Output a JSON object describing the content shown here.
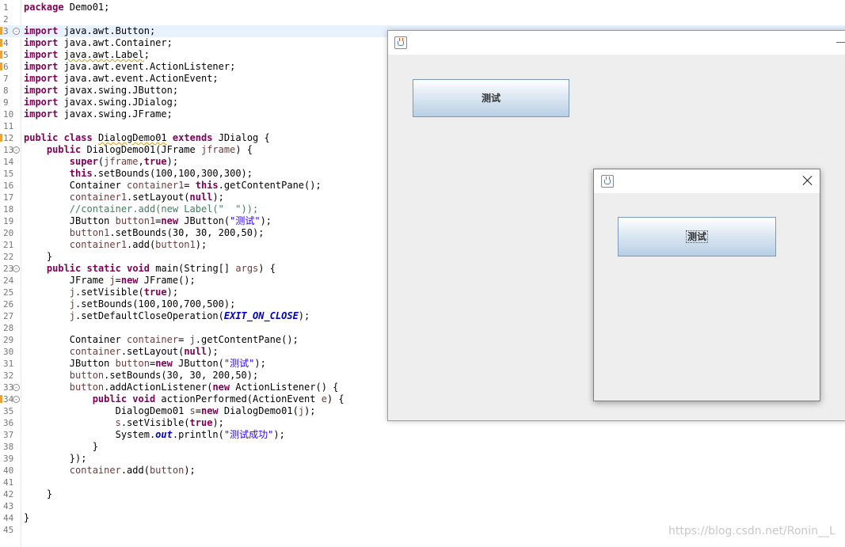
{
  "editor": {
    "lines": [
      {
        "n": "1",
        "tokens": [
          {
            "t": "package",
            "c": "kw"
          },
          {
            "t": " Demo01;"
          }
        ]
      },
      {
        "n": "2",
        "tokens": []
      },
      {
        "n": "3",
        "fold": true,
        "marker": true,
        "hl": true,
        "tokens": [
          {
            "t": "import",
            "c": "kw"
          },
          {
            "t": " java.awt.Button;"
          }
        ]
      },
      {
        "n": "4",
        "marker": true,
        "tokens": [
          {
            "t": "import",
            "c": "kw"
          },
          {
            "t": " java.awt.Container;"
          }
        ]
      },
      {
        "n": "5",
        "marker": true,
        "tokens": [
          {
            "t": "import",
            "c": "kw"
          },
          {
            "t": " "
          },
          {
            "t": "java.awt.Label",
            "c": "squig"
          },
          {
            "t": ";"
          }
        ]
      },
      {
        "n": "6",
        "marker": true,
        "tokens": [
          {
            "t": "import",
            "c": "kw"
          },
          {
            "t": " java.awt.event.ActionListener;"
          }
        ]
      },
      {
        "n": "7",
        "tokens": [
          {
            "t": "import",
            "c": "kw"
          },
          {
            "t": " java.awt.event.ActionEvent;"
          }
        ]
      },
      {
        "n": "8",
        "tokens": [
          {
            "t": "import",
            "c": "kw"
          },
          {
            "t": " javax.swing.JButton;"
          }
        ]
      },
      {
        "n": "9",
        "tokens": [
          {
            "t": "import",
            "c": "kw"
          },
          {
            "t": " javax.swing.JDialog;"
          }
        ]
      },
      {
        "n": "10",
        "tokens": [
          {
            "t": "import",
            "c": "kw"
          },
          {
            "t": " javax.swing.JFrame;"
          }
        ]
      },
      {
        "n": "11",
        "tokens": []
      },
      {
        "n": "12",
        "marker": true,
        "tokens": [
          {
            "t": "public",
            "c": "kw"
          },
          {
            "t": " "
          },
          {
            "t": "class",
            "c": "kw"
          },
          {
            "t": " "
          },
          {
            "t": "DialogDemo01",
            "c": "squig"
          },
          {
            "t": " "
          },
          {
            "t": "extends",
            "c": "kw"
          },
          {
            "t": " JDialog {"
          }
        ]
      },
      {
        "n": "13",
        "fold": true,
        "tokens": [
          {
            "t": "    "
          },
          {
            "t": "public",
            "c": "kw"
          },
          {
            "t": " DialogDemo01(JFrame "
          },
          {
            "t": "jframe",
            "c": "var"
          },
          {
            "t": ") {"
          }
        ]
      },
      {
        "n": "14",
        "tokens": [
          {
            "t": "        "
          },
          {
            "t": "super",
            "c": "kw"
          },
          {
            "t": "("
          },
          {
            "t": "jframe",
            "c": "var"
          },
          {
            "t": ","
          },
          {
            "t": "true",
            "c": "kw"
          },
          {
            "t": ");"
          }
        ]
      },
      {
        "n": "15",
        "tokens": [
          {
            "t": "        "
          },
          {
            "t": "this",
            "c": "kw"
          },
          {
            "t": ".setBounds(100,100,300,300);"
          }
        ]
      },
      {
        "n": "16",
        "tokens": [
          {
            "t": "        Container "
          },
          {
            "t": "container1",
            "c": "var"
          },
          {
            "t": "= "
          },
          {
            "t": "this",
            "c": "kw"
          },
          {
            "t": ".getContentPane();"
          }
        ]
      },
      {
        "n": "17",
        "tokens": [
          {
            "t": "        "
          },
          {
            "t": "container1",
            "c": "var"
          },
          {
            "t": ".setLayout("
          },
          {
            "t": "null",
            "c": "kw"
          },
          {
            "t": ");"
          }
        ]
      },
      {
        "n": "18",
        "tokens": [
          {
            "t": "        "
          },
          {
            "t": "//container.add(new Label(\"  \"));",
            "c": "cm"
          }
        ]
      },
      {
        "n": "19",
        "tokens": [
          {
            "t": "        JButton "
          },
          {
            "t": "button1",
            "c": "var"
          },
          {
            "t": "="
          },
          {
            "t": "new",
            "c": "kw"
          },
          {
            "t": " JButton("
          },
          {
            "t": "\"测试\"",
            "c": "str"
          },
          {
            "t": ");"
          }
        ]
      },
      {
        "n": "20",
        "tokens": [
          {
            "t": "        "
          },
          {
            "t": "button1",
            "c": "var"
          },
          {
            "t": ".setBounds(30, 30, 200,50);"
          }
        ]
      },
      {
        "n": "21",
        "tokens": [
          {
            "t": "        "
          },
          {
            "t": "container1",
            "c": "var"
          },
          {
            "t": ".add("
          },
          {
            "t": "button1",
            "c": "var"
          },
          {
            "t": ");"
          }
        ]
      },
      {
        "n": "22",
        "tokens": [
          {
            "t": "    }"
          }
        ]
      },
      {
        "n": "23",
        "fold": true,
        "tokens": [
          {
            "t": "    "
          },
          {
            "t": "public",
            "c": "kw"
          },
          {
            "t": " "
          },
          {
            "t": "static",
            "c": "kw"
          },
          {
            "t": " "
          },
          {
            "t": "void",
            "c": "kw"
          },
          {
            "t": " main(String[] "
          },
          {
            "t": "args",
            "c": "var"
          },
          {
            "t": ") {"
          }
        ]
      },
      {
        "n": "24",
        "tokens": [
          {
            "t": "        JFrame "
          },
          {
            "t": "j",
            "c": "var"
          },
          {
            "t": "="
          },
          {
            "t": "new",
            "c": "kw"
          },
          {
            "t": " JFrame();"
          }
        ]
      },
      {
        "n": "25",
        "tokens": [
          {
            "t": "        "
          },
          {
            "t": "j",
            "c": "var"
          },
          {
            "t": ".setVisible("
          },
          {
            "t": "true",
            "c": "kw"
          },
          {
            "t": ");"
          }
        ]
      },
      {
        "n": "26",
        "tokens": [
          {
            "t": "        "
          },
          {
            "t": "j",
            "c": "var"
          },
          {
            "t": ".setBounds(100,100,700,500);"
          }
        ]
      },
      {
        "n": "27",
        "tokens": [
          {
            "t": "        "
          },
          {
            "t": "j",
            "c": "var"
          },
          {
            "t": ".setDefaultCloseOperation("
          },
          {
            "t": "EXIT_ON_CLOSE",
            "c": "fld"
          },
          {
            "t": ");"
          }
        ]
      },
      {
        "n": "28",
        "tokens": []
      },
      {
        "n": "29",
        "tokens": [
          {
            "t": "        Container "
          },
          {
            "t": "container",
            "c": "var"
          },
          {
            "t": "= "
          },
          {
            "t": "j",
            "c": "var"
          },
          {
            "t": ".getContentPane();"
          }
        ]
      },
      {
        "n": "30",
        "tokens": [
          {
            "t": "        "
          },
          {
            "t": "container",
            "c": "var"
          },
          {
            "t": ".setLayout("
          },
          {
            "t": "null",
            "c": "kw"
          },
          {
            "t": ");"
          }
        ]
      },
      {
        "n": "31",
        "tokens": [
          {
            "t": "        JButton "
          },
          {
            "t": "button",
            "c": "var"
          },
          {
            "t": "="
          },
          {
            "t": "new",
            "c": "kw"
          },
          {
            "t": " JButton("
          },
          {
            "t": "\"测试\"",
            "c": "str"
          },
          {
            "t": ");"
          }
        ]
      },
      {
        "n": "32",
        "tokens": [
          {
            "t": "        "
          },
          {
            "t": "button",
            "c": "var"
          },
          {
            "t": ".setBounds(30, 30, 200,50);"
          }
        ]
      },
      {
        "n": "33",
        "fold": true,
        "tokens": [
          {
            "t": "        "
          },
          {
            "t": "button",
            "c": "var"
          },
          {
            "t": ".addActionListener("
          },
          {
            "t": "new",
            "c": "kw"
          },
          {
            "t": " ActionListener() {"
          }
        ]
      },
      {
        "n": "34",
        "fold": true,
        "marker": true,
        "tokens": [
          {
            "t": "            "
          },
          {
            "t": "public",
            "c": "kw"
          },
          {
            "t": " "
          },
          {
            "t": "void",
            "c": "kw"
          },
          {
            "t": " actionPerformed(ActionEvent "
          },
          {
            "t": "e",
            "c": "var"
          },
          {
            "t": ") {"
          }
        ]
      },
      {
        "n": "35",
        "tokens": [
          {
            "t": "                DialogDemo01 "
          },
          {
            "t": "s",
            "c": "var"
          },
          {
            "t": "="
          },
          {
            "t": "new",
            "c": "kw"
          },
          {
            "t": " DialogDemo01("
          },
          {
            "t": "j",
            "c": "var"
          },
          {
            "t": ");"
          }
        ]
      },
      {
        "n": "36",
        "tokens": [
          {
            "t": "                "
          },
          {
            "t": "s",
            "c": "var"
          },
          {
            "t": ".setVisible("
          },
          {
            "t": "true",
            "c": "kw"
          },
          {
            "t": ");"
          }
        ]
      },
      {
        "n": "37",
        "tokens": [
          {
            "t": "                System."
          },
          {
            "t": "out",
            "c": "fld"
          },
          {
            "t": ".println("
          },
          {
            "t": "\"测试成功\"",
            "c": "str"
          },
          {
            "t": ");"
          }
        ]
      },
      {
        "n": "38",
        "tokens": [
          {
            "t": "            }"
          }
        ]
      },
      {
        "n": "39",
        "tokens": [
          {
            "t": "        });"
          }
        ]
      },
      {
        "n": "40",
        "tokens": [
          {
            "t": "        "
          },
          {
            "t": "container",
            "c": "var"
          },
          {
            "t": ".add("
          },
          {
            "t": "button",
            "c": "var"
          },
          {
            "t": ");"
          }
        ]
      },
      {
        "n": "41",
        "tokens": []
      },
      {
        "n": "42",
        "tokens": [
          {
            "t": "    }"
          }
        ]
      },
      {
        "n": "43",
        "tokens": []
      },
      {
        "n": "44",
        "tokens": [
          {
            "t": "}"
          }
        ]
      },
      {
        "n": "45",
        "tokens": []
      }
    ]
  },
  "frame": {
    "button_label": "测试"
  },
  "dialog": {
    "button_label": "测试"
  },
  "watermark": "https://blog.csdn.net/Ronin__L"
}
